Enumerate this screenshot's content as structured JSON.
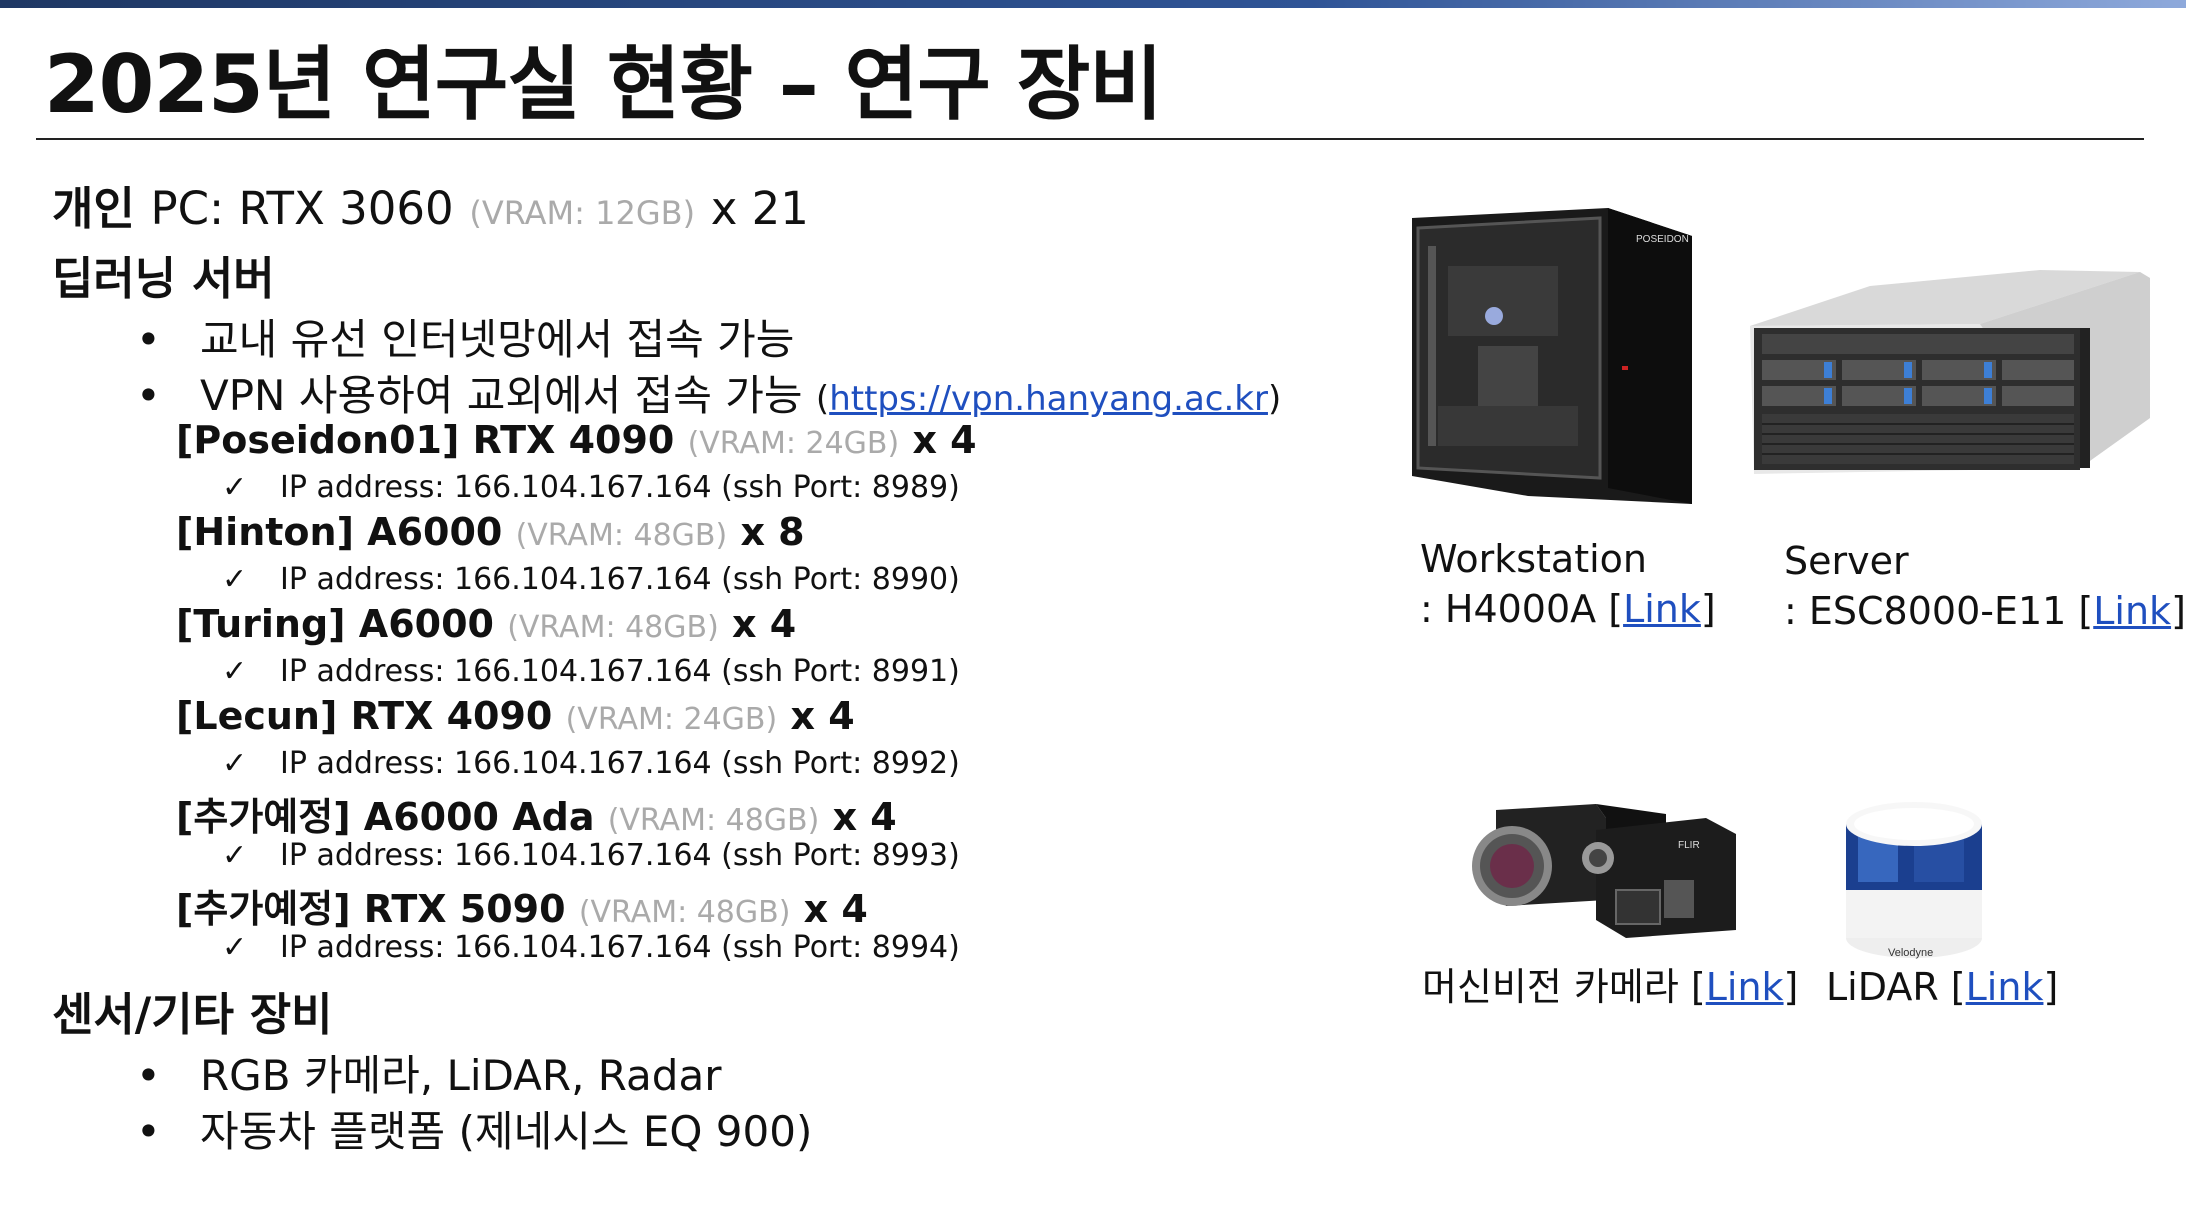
{
  "title": "2025년 연구실 현황 – 연구 장비",
  "personal_pc": {
    "heading": "개인",
    "label": "PC: RTX 3060",
    "vram": "(VRAM: 12GB)",
    "count": "x 21"
  },
  "dl_server": {
    "heading": "딥러닝 서버",
    "bullets": [
      {
        "text": "교내 유선 인터넷망에서 접속 가능"
      },
      {
        "text": "VPN 사용하여 교외에서 접속 가능",
        "paren_open": "(",
        "link": "https://vpn.hanyang.ac.kr",
        "paren_close": ")"
      }
    ],
    "servers": [
      {
        "name": "[Poseidon01] RTX 4090",
        "vram": "(VRAM: 24GB)",
        "count": "x 4",
        "ip": "IP address: 166.104.167.164 (ssh Port: 8989)"
      },
      {
        "name": "[Hinton] A6000",
        "vram": "(VRAM: 48GB)",
        "count": "x 8",
        "ip": "IP address: 166.104.167.164 (ssh Port: 8990)"
      },
      {
        "name": "[Turing] A6000",
        "vram": "(VRAM: 48GB)",
        "count": "x 4",
        "ip": "IP address: 166.104.167.164 (ssh Port: 8991)"
      },
      {
        "name": "[Lecun] RTX 4090",
        "vram": "(VRAM: 24GB)",
        "count": "x 4",
        "ip": "IP address: 166.104.167.164 (ssh Port: 8992)"
      },
      {
        "name": "[추가예정] A6000 Ada",
        "vram": "(VRAM: 48GB)",
        "count": "x 4",
        "ip": "IP address: 166.104.167.164 (ssh Port: 8993)"
      },
      {
        "name": "[추가예정] RTX 5090",
        "vram": "(VRAM: 48GB)",
        "count": "x 4",
        "ip": "IP address: 166.104.167.164 (ssh Port: 8994)"
      }
    ]
  },
  "sensors": {
    "heading": "센서/기타 장비",
    "bullets": [
      "RGB 카메라, LiDAR, Radar",
      "자동차 플랫폼 (제네시스 EQ 900)"
    ]
  },
  "bullet_glyph": "•",
  "check_glyph": "✓",
  "figures": {
    "workstation": {
      "line1": "Workstation",
      "line2_prefix": ": H4000A [",
      "link": "Link",
      "suffix": "]"
    },
    "server": {
      "line1": "Server",
      "line2_prefix": ": ESC8000-E11 [",
      "link": "Link",
      "suffix": "]"
    },
    "camera": {
      "prefix": "머신비전 카메라 [",
      "link": "Link",
      "suffix": "]"
    },
    "lidar": {
      "prefix": "LiDAR [",
      "link": "Link",
      "suffix": "]",
      "brand": "Velodyne"
    },
    "poseidon_brand": "POSEIDON",
    "flir_brand": "FLIR"
  },
  "colors": {
    "link": "#1f4fbf",
    "vram_gray": "#aaaaaa",
    "accent_bar": "#2f5496"
  }
}
